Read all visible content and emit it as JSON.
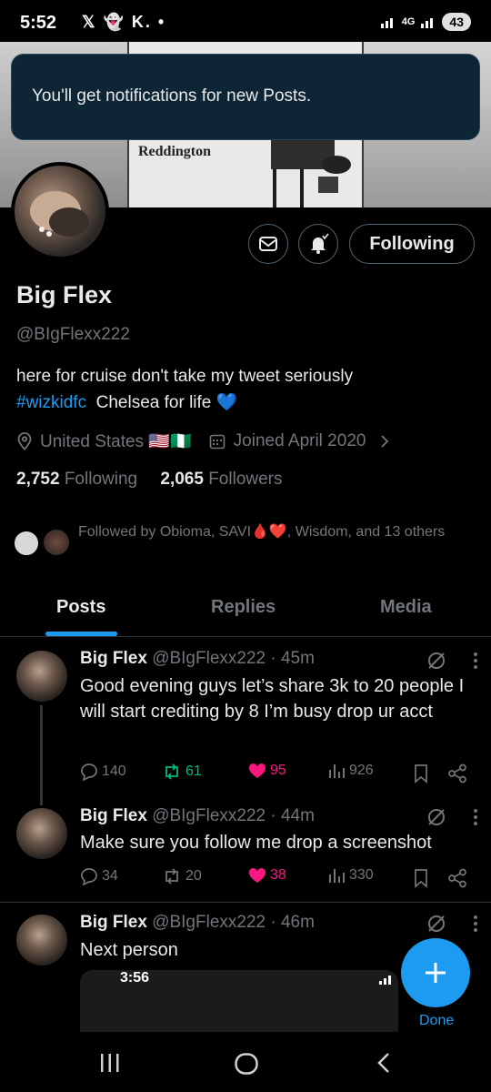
{
  "status_bar": {
    "time": "5:52",
    "app_icons": "𝕏 👻 K. •",
    "network": "4G",
    "battery": "43"
  },
  "banner": {
    "caption": "Reddington"
  },
  "toast": {
    "message": "You'll get notifications for new Posts."
  },
  "profile": {
    "follow_label": "Following",
    "name": "Big Flex",
    "handle": "@BIgFlexx222",
    "bio_text_1": "here for cruise don't take my tweet seriously",
    "bio_hashtag": "#wizkidfc",
    "bio_text_2": "Chelsea for life 💙",
    "location": "United States 🇺🇸🇳🇬",
    "joined": "Joined April 2020",
    "following_count": "2,752",
    "following_label": "Following",
    "followers_count": "2,065",
    "followers_label": "Followers",
    "followed_by": "Followed by Obioma, SAVI🩸❤️, Wisdom, and 13 others"
  },
  "tabs": [
    {
      "label": "Posts",
      "active": true
    },
    {
      "label": "Replies",
      "active": false
    },
    {
      "label": "Media",
      "active": false
    }
  ],
  "posts": [
    {
      "name": "Big Flex",
      "handle": "@BIgFlexx222",
      "time": "· 45m",
      "text": "Good evening guys let’s share 3k to 20 people I will start crediting by 8 I’m busy drop ur acct",
      "replies": "140",
      "reposts": "61",
      "likes": "95",
      "views": "926"
    },
    {
      "name": "Big Flex",
      "handle": "@BIgFlexx222",
      "time": "· 44m",
      "text": "Make sure you follow me drop a screenshot",
      "replies": "34",
      "reposts": "20",
      "likes": "38",
      "views": "330"
    },
    {
      "name": "Big Flex",
      "handle": "@BIgFlexx222",
      "time": "· 46m",
      "text": "Next person"
    }
  ],
  "pip": {
    "time": "3:56"
  },
  "fab": {
    "done_label": "Done"
  },
  "colors": {
    "accent": "#1d9bf0",
    "like": "#f91880",
    "repost": "#00ba7c",
    "muted": "#71767b",
    "background": "#000000"
  }
}
